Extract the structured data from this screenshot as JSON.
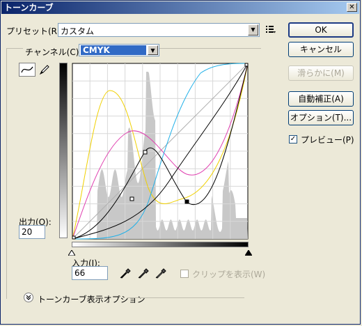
{
  "window": {
    "title": "トーンカーブ",
    "close_glyph": "✕"
  },
  "preset": {
    "label": "プリセット(R):",
    "value": "カスタム"
  },
  "channel": {
    "label": "チャンネル(C):",
    "value": "CMYK"
  },
  "buttons": {
    "ok": "OK",
    "cancel": "キャンセル",
    "smooth": "滑らかに(M)",
    "auto": "自動補正(A)",
    "options": "オプション(T)..."
  },
  "preview": {
    "label": "プレビュー(P)",
    "checked": true
  },
  "output": {
    "label": "出力(O):",
    "value": "20"
  },
  "input": {
    "label": "入力(I):",
    "value": "66"
  },
  "clip": {
    "label": "クリップを表示(W)",
    "checked": false
  },
  "curve_display_options": {
    "label": "トーンカーブ表示オプション"
  },
  "icons": {
    "preset_menu": "menu-list-icon",
    "curve_tool": "curve-point-icon",
    "pencil_tool": "pencil-icon",
    "black_eyedropper": "eyedropper-black-icon",
    "gray_eyedropper": "eyedropper-gray-icon",
    "white_eyedropper": "eyedropper-white-icon",
    "expand": "expand-chevron-icon"
  },
  "colors": {
    "yellow": "#f0d000",
    "magenta": "#e040b0",
    "cyan": "#20b0e8",
    "black": "#000000",
    "histogram": "#c8c8c8",
    "accent": "#0a246a"
  }
}
